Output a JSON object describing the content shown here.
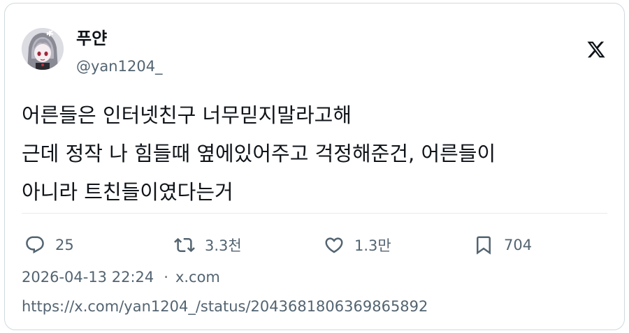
{
  "author": {
    "display_name": "푸얀",
    "handle": "@yan1204_"
  },
  "tweet": {
    "lines": [
      "어른들은 인터넷친구 너무믿지말라고해",
      "근데 정작 나 힘들때 옆에있어주고 걱정해준건, 어른들이",
      "아니라 트친들이였다는거"
    ]
  },
  "actions": {
    "replies": "25",
    "retweets": "3.3천",
    "likes": "1.3만",
    "bookmarks": "704"
  },
  "meta": {
    "timestamp": "2026-04-13 22:24",
    "separator": "·",
    "source": "x.com"
  },
  "url": "https://x.com/yan1204_/status/2043681806369865892",
  "icons": {
    "platform": "x-logo-icon",
    "reply": "reply-icon",
    "retweet": "retweet-icon",
    "like": "heart-icon",
    "bookmark": "bookmark-icon"
  },
  "colors": {
    "text_primary": "#0f1419",
    "text_secondary": "#536471",
    "border": "#cfd9de"
  }
}
